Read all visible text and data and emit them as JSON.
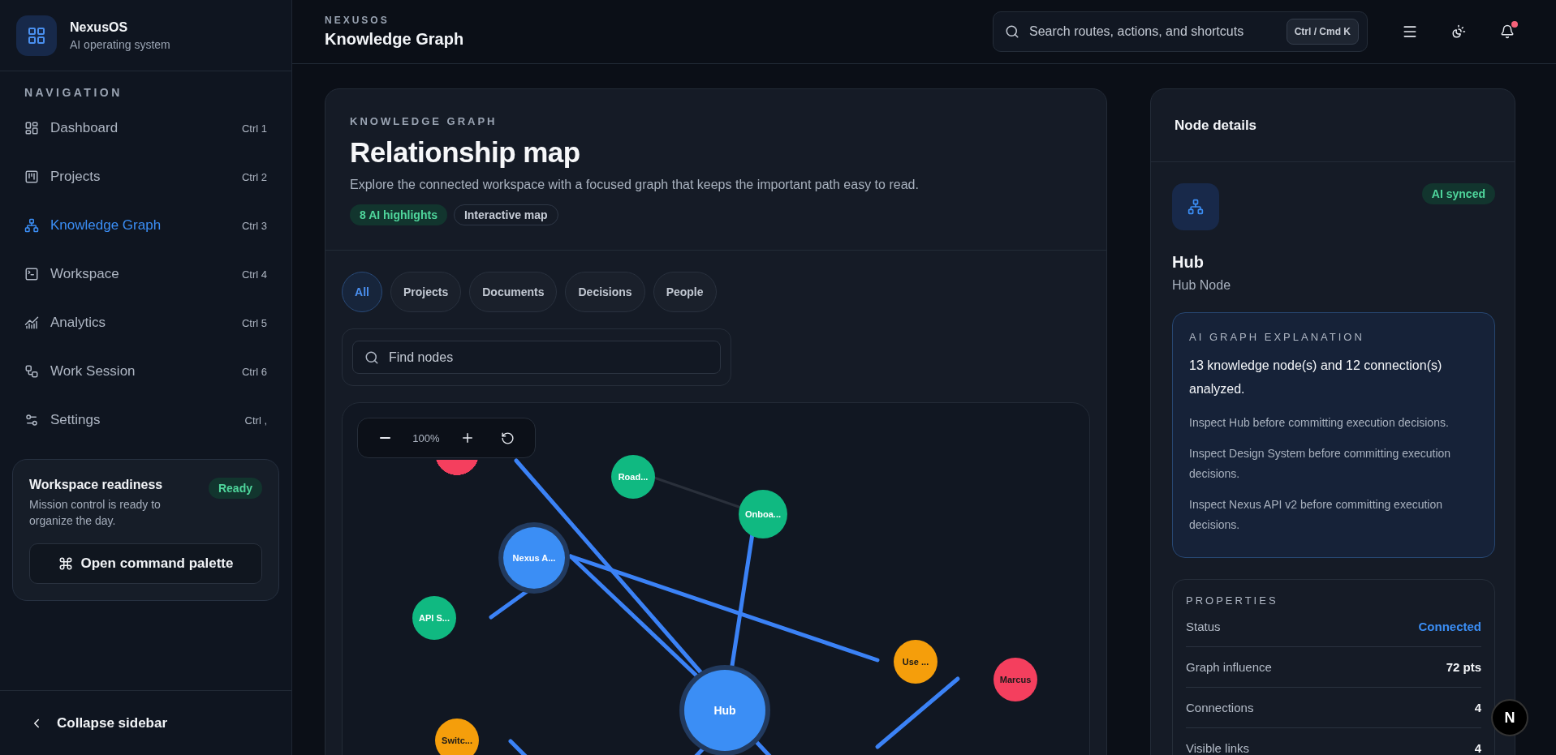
{
  "brand": {
    "name": "NexusOS",
    "tagline": "AI operating system"
  },
  "sidebar": {
    "section_label": "NAVIGATION",
    "items": [
      {
        "kind": "dashboard",
        "label": "Dashboard",
        "shortcut": "Ctrl 1",
        "selected": false
      },
      {
        "kind": "projects",
        "label": "Projects",
        "shortcut": "Ctrl 2",
        "selected": false
      },
      {
        "kind": "graph",
        "label": "Knowledge Graph",
        "shortcut": "Ctrl 3",
        "selected": true
      },
      {
        "kind": "workspace",
        "label": "Workspace",
        "shortcut": "Ctrl 4",
        "selected": false
      },
      {
        "kind": "analytics",
        "label": "Analytics",
        "shortcut": "Ctrl 5",
        "selected": false
      },
      {
        "kind": "session",
        "label": "Work Session",
        "shortcut": "Ctrl 6",
        "selected": false
      },
      {
        "kind": "settings",
        "label": "Settings",
        "shortcut": "Ctrl ,",
        "selected": false
      }
    ],
    "readiness": {
      "title": "Workspace readiness",
      "text": "Mission control is ready to organize the day.",
      "badge": "Ready",
      "button": "Open command palette"
    },
    "collapse": "Collapse sidebar"
  },
  "header": {
    "eyebrow": "NEXUSOS",
    "title": "Knowledge Graph",
    "search": {
      "placeholder": "Search routes, actions, and shortcuts",
      "shortcut": "Ctrl / Cmd K"
    },
    "notification_dot": true
  },
  "main": {
    "eyebrow": "KNOWLEDGE GRAPH",
    "title": "Relationship map",
    "description": "Explore the connected workspace with a focused graph that keeps the important path easy to read.",
    "badges": [
      {
        "label": "8 AI highlights",
        "kind": "accent"
      },
      {
        "label": "Interactive map",
        "kind": "outline"
      }
    ],
    "filters": [
      {
        "label": "All",
        "selected": true
      },
      {
        "label": "Projects",
        "selected": false
      },
      {
        "label": "Documents",
        "selected": false
      },
      {
        "label": "Decisions",
        "selected": false
      },
      {
        "label": "People",
        "selected": false
      }
    ],
    "find": {
      "placeholder": "Find nodes"
    },
    "zoom": {
      "reading": "100%"
    },
    "nodes": [
      {
        "color": "#f43f5e",
        "highlighted": false
      },
      {
        "label": "Road...",
        "color": "#10b981",
        "highlighted": false
      },
      {
        "label": "Onboa...",
        "color": "#10b981",
        "highlighted": false
      },
      {
        "label": "Nexus A...",
        "color": "#3b8ef5",
        "highlighted": true
      },
      {
        "label": "API S...",
        "color": "#10b981",
        "highlighted": false
      },
      {
        "label": "Use ...",
        "color": "#f59e0b",
        "highlighted": false
      },
      {
        "label": "Marcus",
        "color": "#f43f5e",
        "highlighted": false
      },
      {
        "label": "Hub",
        "color": "#3b8ef5",
        "highlighted": true
      },
      {
        "label": "Switc...",
        "color": "#f59e0b",
        "highlighted": false
      }
    ]
  },
  "details": {
    "title": "Node details",
    "badge": "AI synced",
    "node_title": "Hub",
    "node_subtitle": "Hub Node",
    "explanation": {
      "label": "AI GRAPH EXPLANATION",
      "summary": "13 knowledge node(s) and 12 connection(s) analyzed.",
      "items": [
        "Inspect Hub before committing execution decisions.",
        "Inspect Design System before committing execution decisions.",
        "Inspect Nexus API v2 before committing execution decisions."
      ]
    },
    "properties": {
      "label": "PROPERTIES",
      "rows": [
        {
          "name": "Status",
          "value": "Connected",
          "kind": "status"
        },
        {
          "name": "Graph influence",
          "value": "72 pts",
          "kind": "plain"
        },
        {
          "name": "Connections",
          "value": "4",
          "kind": "plain"
        },
        {
          "name": "Visible links",
          "value": "4",
          "kind": "plain"
        }
      ]
    }
  },
  "dev_badge": "N"
}
